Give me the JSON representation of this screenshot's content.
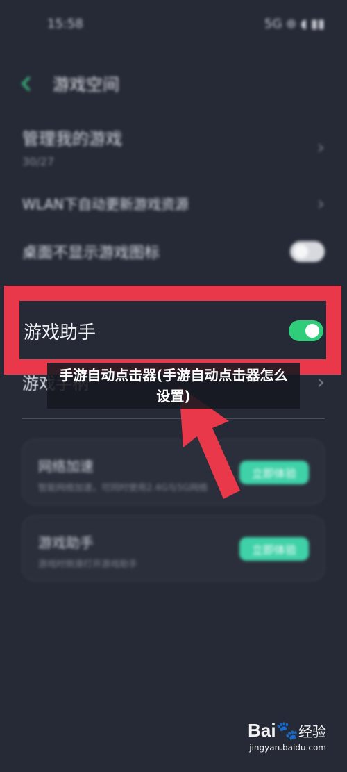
{
  "status_bar": {
    "time": "15:58",
    "indicators": "5G ⊛ ◖ ▮▮"
  },
  "header": {
    "title": "游戏空间"
  },
  "settings": {
    "manage_games": {
      "title": "管理我的游戏",
      "subtitle": "30/27"
    },
    "wlan_row": {
      "title": "WLAN下自动更新游戏资源"
    },
    "desktop_icon_row": {
      "title": "桌面不显示游戏图标",
      "toggle_state": "off"
    },
    "game_assistant": {
      "title": "游戏助手",
      "toggle_state": "on"
    },
    "gamepad_row": {
      "title": "游戏手柄"
    }
  },
  "cards": [
    {
      "title": "网络加速",
      "desc": "智能网络加速，可同时使用2.4G与5G网络",
      "button": "立即体验"
    },
    {
      "title": "游戏助手",
      "desc": "游戏时侧滑打开游戏助手",
      "button": "立即体验"
    }
  ],
  "caption": {
    "text": "手游自动点击器(手游自动点击器怎么设置)"
  },
  "watermark": {
    "logo_left": "Bai",
    "logo_paw": "🐾",
    "logo_right": "经验",
    "url": "jingyan.baidu.com"
  },
  "colors": {
    "background": "#262a36",
    "highlight": "#e8384a",
    "toggle_on": "#2fcc7a",
    "accent": "#3fd1a8"
  }
}
